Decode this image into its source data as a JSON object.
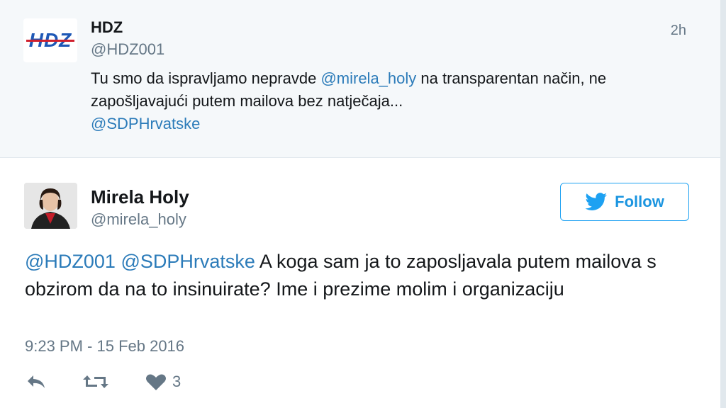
{
  "parent_tweet": {
    "avatar_logo_text": "HDZ",
    "name": "HDZ",
    "handle": "@HDZ001",
    "time": "2h",
    "text_before_mention": "Tu smo da ispravljamo nepravde ",
    "mention_1": "@mirela_holy",
    "text_after_mention": " na transparentan način, ne zapošljavajući putem mailova bez natječaja...",
    "mention_2": "@SDPHrvatske"
  },
  "main_tweet": {
    "name": "Mirela Holy",
    "handle": "@mirela_holy",
    "follow_label": "Follow",
    "mention_1": "@HDZ001",
    "mention_2": "@SDPHrvatske",
    "text": " A koga sam ja to zaposljavala putem mailova s obzirom da na to insinuirate? Ime i prezime molim i organizaciju",
    "timestamp": "9:23 PM - 15 Feb 2016",
    "like_count": "3"
  },
  "icons": {
    "reply": "reply-icon",
    "retweet": "retweet-icon",
    "like": "heart-icon",
    "follow": "twitter-bird-icon"
  },
  "colors": {
    "link": "#2b7bb9",
    "accent": "#1da1f2",
    "muted": "#657786",
    "parent_bg": "#f5f8fa",
    "hdz_blue": "#1e58b6",
    "hdz_red": "#d0202e"
  }
}
